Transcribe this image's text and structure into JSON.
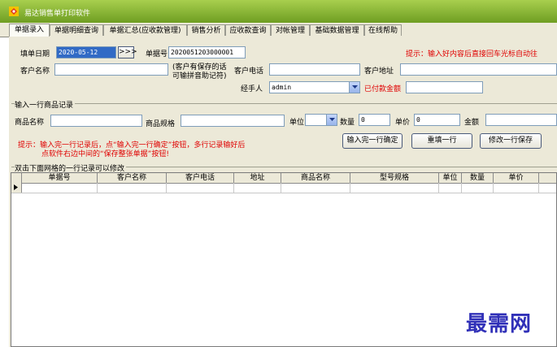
{
  "window": {
    "title": "易达销售单打印软件"
  },
  "tabs": [
    "单据录入",
    "单据明细查询",
    "单据汇总(应收款管理)",
    "销售分析",
    "应收款查询",
    "对帐管理",
    "基础数据管理",
    "在线帮助"
  ],
  "form": {
    "date_label": "填单日期",
    "date_value": "2020-05-12",
    "date_button": ">>>",
    "bill_no_label": "单据号",
    "bill_no_value": "2020051203000001",
    "hint_top": "提示：输入好内容后直接回车光标自动往",
    "customer_name_label": "客户名称",
    "customer_note_line1": "(客户有保存的话",
    "customer_note_line2": "可输拼音助记符)",
    "customer_phone_label": "客户电话",
    "customer_address_label": "客户地址",
    "handler_label": "经手人",
    "handler_value": "admin",
    "paid_label": "已付款金额"
  },
  "item_section": {
    "title": "输入一行商品记录",
    "product_name_label": "商品名称",
    "product_spec_label": "商品规格",
    "unit_label": "单位",
    "quantity_label": "数量",
    "quantity_value": "0",
    "price_label": "单价",
    "price_value": "0",
    "amount_label": "金额",
    "hint_line1": "提示：输入完一行记录后，点“输入完一行确定”按钮，多行记录输好后",
    "hint_line2": "点软件右边中间的“保存整张单据”按钮!",
    "confirm_button": "输入完一行确定",
    "refill_button": "重填一行",
    "modify_button": "修改一行保存"
  },
  "grid": {
    "caption": "双击下面网格的一行记录可以修改",
    "columns": [
      "单据号",
      "客户名称",
      "客户电话",
      "地址",
      "商品名称",
      "型号规格",
      "单位",
      "数量",
      "单价"
    ]
  },
  "watermark": "最需网",
  "colors": {
    "title_bar": "#86b433",
    "hint_red": "#e00000",
    "selection_blue": "#316ac5",
    "watermark": "#3030b8"
  }
}
